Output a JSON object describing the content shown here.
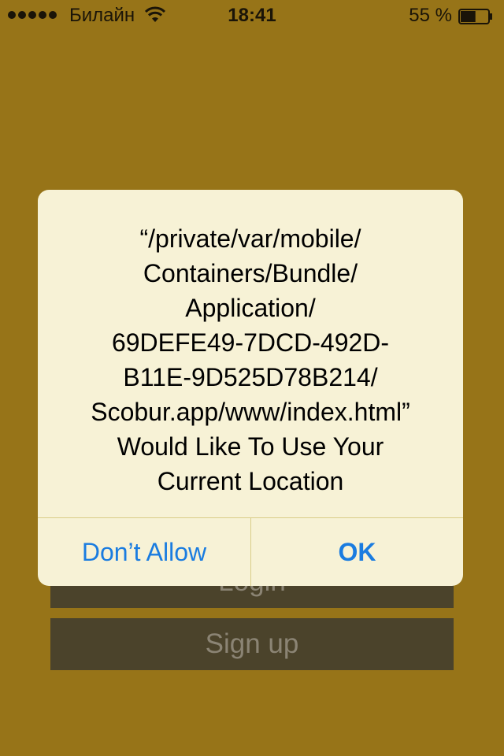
{
  "status_bar": {
    "carrier": "Билайн",
    "time": "18:41",
    "battery_percent": "55 %",
    "signal_bars": 5,
    "battery_level": 0.55,
    "icons": [
      "signal-dots-icon",
      "wifi-icon",
      "battery-icon"
    ]
  },
  "background": {
    "color": "#977418",
    "login_label": "Login",
    "signup_label": "Sign up"
  },
  "alert": {
    "message": "“/private/var/mobile/\nContainers/Bundle/\nApplication/\n69DEFE49-7DCD-492D-\nB11E-9D525D78B214/\nScobur.app/www/index.html”\nWould Like To Use Your\nCurrent Location",
    "dont_allow_label": "Don’t Allow",
    "ok_label": "OK",
    "accent_color": "#1a7ce0"
  }
}
